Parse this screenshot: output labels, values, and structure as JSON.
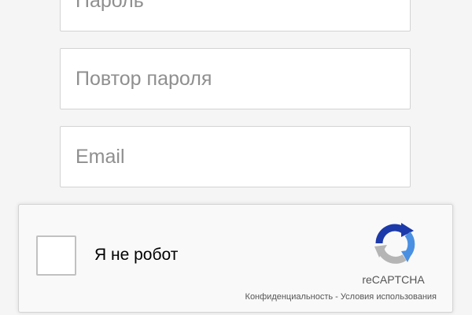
{
  "form": {
    "fields": [
      {
        "placeholder": "Пароль",
        "value": ""
      },
      {
        "placeholder": "Повтор пароля",
        "value": ""
      },
      {
        "placeholder": "Email",
        "value": ""
      }
    ]
  },
  "captcha": {
    "label": "Я не робот",
    "brand": "reCAPTCHA",
    "privacy_link": "Конфиденциальность",
    "separator": " - ",
    "terms_link": "Условия использования",
    "checked": false,
    "colors": {
      "blue": "#1c3aa9",
      "light_blue": "#4a90e2",
      "gray": "#b5b5b5"
    },
    "icon": "recaptcha-logo-icon"
  },
  "colors": {
    "background": "#f5f5f5",
    "field_border": "#d3d3d3",
    "placeholder": "#8f8f8f"
  }
}
